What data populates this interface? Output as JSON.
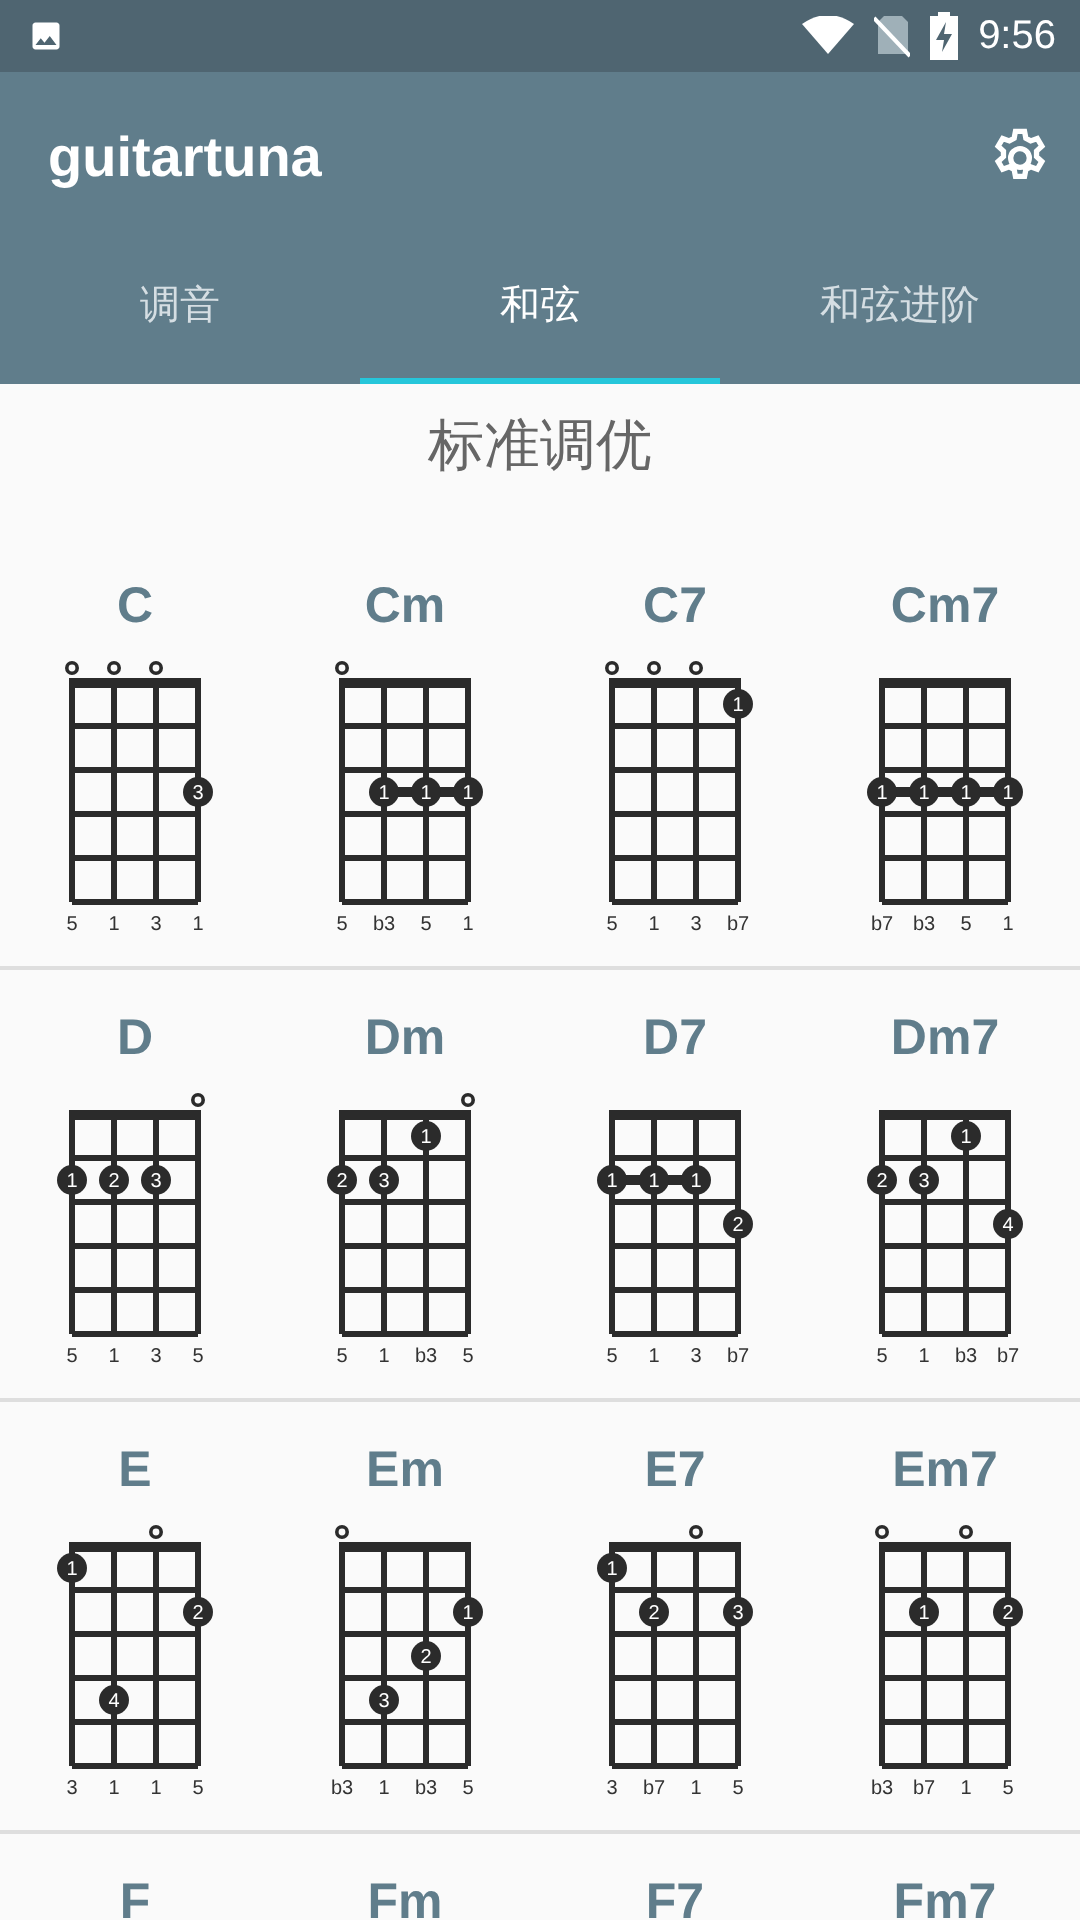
{
  "status_bar": {
    "time": "9:56"
  },
  "app_bar": {
    "title": "guitartuna"
  },
  "tabs": [
    {
      "label": "调音",
      "selected": false
    },
    {
      "label": "和弦",
      "selected": true
    },
    {
      "label": "和弦进阶",
      "selected": false
    }
  ],
  "tuning_title": "标准调优",
  "chords": [
    {
      "name": "C",
      "strings": [
        {
          "interval": "5",
          "open": true
        },
        {
          "interval": "1",
          "open": true
        },
        {
          "interval": "3",
          "open": true
        },
        {
          "interval": "1",
          "open": false,
          "frets": [
            {
              "dot": false
            },
            {
              "dot": false
            },
            {
              "dot": true,
              "finger": "3",
              "barre": false
            }
          ]
        }
      ]
    },
    {
      "name": "Cm",
      "strings": [
        {
          "interval": "5",
          "open": true
        },
        {
          "interval": "b3",
          "open": false,
          "frets": [
            {
              "dot": false
            },
            {
              "dot": false
            },
            {
              "dot": true,
              "finger": "1",
              "barre": true
            }
          ]
        },
        {
          "interval": "5",
          "open": false,
          "frets": [
            {
              "dot": false
            },
            {
              "dot": false
            },
            {
              "dot": true,
              "finger": "1",
              "barre": true
            }
          ]
        },
        {
          "interval": "1",
          "open": false,
          "frets": [
            {
              "dot": false
            },
            {
              "dot": false
            },
            {
              "dot": true,
              "finger": "1",
              "barre": false
            }
          ]
        }
      ]
    },
    {
      "name": "C7",
      "strings": [
        {
          "interval": "5",
          "open": true
        },
        {
          "interval": "1",
          "open": true
        },
        {
          "interval": "3",
          "open": true
        },
        {
          "interval": "b7",
          "open": false,
          "frets": [
            {
              "dot": true,
              "finger": "1",
              "barre": false
            }
          ]
        }
      ]
    },
    {
      "name": "Cm7",
      "strings": [
        {
          "interval": "b7",
          "open": false,
          "frets": [
            {
              "dot": false
            },
            {
              "dot": false
            },
            {
              "dot": true,
              "finger": "1",
              "barre": true
            }
          ]
        },
        {
          "interval": "b3",
          "open": false,
          "frets": [
            {
              "dot": false
            },
            {
              "dot": false
            },
            {
              "dot": true,
              "finger": "1",
              "barre": true
            }
          ]
        },
        {
          "interval": "5",
          "open": false,
          "frets": [
            {
              "dot": false
            },
            {
              "dot": false
            },
            {
              "dot": true,
              "finger": "1",
              "barre": true
            }
          ]
        },
        {
          "interval": "1",
          "open": false,
          "frets": [
            {
              "dot": false
            },
            {
              "dot": false
            },
            {
              "dot": true,
              "finger": "1",
              "barre": false
            }
          ]
        }
      ]
    },
    {
      "name": "D",
      "strings": [
        {
          "interval": "5",
          "open": false,
          "frets": [
            {
              "dot": false
            },
            {
              "dot": true,
              "finger": "1",
              "barre": false
            }
          ]
        },
        {
          "interval": "1",
          "open": false,
          "frets": [
            {
              "dot": false
            },
            {
              "dot": true,
              "finger": "2",
              "barre": false
            }
          ]
        },
        {
          "interval": "3",
          "open": false,
          "frets": [
            {
              "dot": false
            },
            {
              "dot": true,
              "finger": "3",
              "barre": false
            }
          ]
        },
        {
          "interval": "5",
          "open": true
        }
      ]
    },
    {
      "name": "Dm",
      "strings": [
        {
          "interval": "5",
          "open": false,
          "frets": [
            {
              "dot": false
            },
            {
              "dot": true,
              "finger": "2",
              "barre": false
            }
          ]
        },
        {
          "interval": "1",
          "open": false,
          "frets": [
            {
              "dot": false
            },
            {
              "dot": true,
              "finger": "3",
              "barre": false
            }
          ]
        },
        {
          "interval": "b3",
          "open": false,
          "frets": [
            {
              "dot": true,
              "finger": "1",
              "barre": false
            }
          ]
        },
        {
          "interval": "5",
          "open": true
        }
      ]
    },
    {
      "name": "D7",
      "strings": [
        {
          "interval": "5",
          "open": false,
          "frets": [
            {
              "dot": false
            },
            {
              "dot": true,
              "finger": "1",
              "barre": true
            }
          ]
        },
        {
          "interval": "1",
          "open": false,
          "frets": [
            {
              "dot": false
            },
            {
              "dot": true,
              "finger": "1",
              "barre": true
            }
          ]
        },
        {
          "interval": "3",
          "open": false,
          "frets": [
            {
              "dot": false
            },
            {
              "dot": true,
              "finger": "1",
              "barre": false
            }
          ]
        },
        {
          "interval": "b7",
          "open": false,
          "frets": [
            {
              "dot": false
            },
            {
              "dot": false
            },
            {
              "dot": true,
              "finger": "2",
              "barre": false
            }
          ]
        }
      ]
    },
    {
      "name": "Dm7",
      "strings": [
        {
          "interval": "5",
          "open": false,
          "frets": [
            {
              "dot": false
            },
            {
              "dot": true,
              "finger": "2",
              "barre": false
            }
          ]
        },
        {
          "interval": "1",
          "open": false,
          "frets": [
            {
              "dot": false
            },
            {
              "dot": true,
              "finger": "3",
              "barre": false
            }
          ]
        },
        {
          "interval": "b3",
          "open": false,
          "frets": [
            {
              "dot": true,
              "finger": "1",
              "barre": false
            }
          ]
        },
        {
          "interval": "b7",
          "open": false,
          "frets": [
            {
              "dot": false
            },
            {
              "dot": false
            },
            {
              "dot": true,
              "finger": "4",
              "barre": false
            }
          ]
        }
      ]
    },
    {
      "name": "E",
      "strings": [
        {
          "interval": "3",
          "open": false,
          "frets": [
            {
              "dot": true,
              "finger": "1",
              "barre": false
            }
          ]
        },
        {
          "interval": "1",
          "open": false,
          "frets": [
            {
              "dot": false
            },
            {
              "dot": false
            },
            {
              "dot": false
            },
            {
              "dot": true,
              "finger": "4",
              "barre": false
            }
          ]
        },
        {
          "interval": "1",
          "open": true
        },
        {
          "interval": "5",
          "open": false,
          "frets": [
            {
              "dot": false
            },
            {
              "dot": true,
              "finger": "2",
              "barre": false
            }
          ]
        }
      ]
    },
    {
      "name": "Em",
      "strings": [
        {
          "interval": "b3",
          "open": true
        },
        {
          "interval": "1",
          "open": false,
          "frets": [
            {
              "dot": false
            },
            {
              "dot": false
            },
            {
              "dot": false
            },
            {
              "dot": true,
              "finger": "3",
              "barre": false
            }
          ]
        },
        {
          "interval": "b3",
          "open": false,
          "frets": [
            {
              "dot": false
            },
            {
              "dot": false
            },
            {
              "dot": true,
              "finger": "2",
              "barre": false
            }
          ]
        },
        {
          "interval": "5",
          "open": false,
          "frets": [
            {
              "dot": false
            },
            {
              "dot": true,
              "finger": "1",
              "barre": false
            }
          ]
        }
      ]
    },
    {
      "name": "E7",
      "strings": [
        {
          "interval": "3",
          "open": false,
          "frets": [
            {
              "dot": true,
              "finger": "1",
              "barre": false
            }
          ]
        },
        {
          "interval": "b7",
          "open": false,
          "frets": [
            {
              "dot": false
            },
            {
              "dot": true,
              "finger": "2",
              "barre": false
            }
          ]
        },
        {
          "interval": "1",
          "open": true
        },
        {
          "interval": "5",
          "open": false,
          "frets": [
            {
              "dot": false
            },
            {
              "dot": true,
              "finger": "3",
              "barre": false
            }
          ]
        }
      ]
    },
    {
      "name": "Em7",
      "strings": [
        {
          "interval": "b3",
          "open": true
        },
        {
          "interval": "b7",
          "open": false,
          "frets": [
            {
              "dot": false
            },
            {
              "dot": true,
              "finger": "1",
              "barre": false
            }
          ]
        },
        {
          "interval": "1",
          "open": true
        },
        {
          "interval": "5",
          "open": false,
          "frets": [
            {
              "dot": false
            },
            {
              "dot": true,
              "finger": "2",
              "barre": false
            }
          ]
        }
      ]
    },
    {
      "name": "F"
    },
    {
      "name": "Fm"
    },
    {
      "name": "F7"
    },
    {
      "name": "Fm7"
    }
  ]
}
